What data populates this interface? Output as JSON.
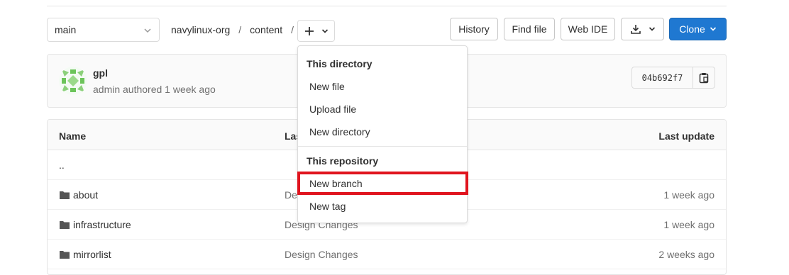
{
  "toolbar": {
    "branch": "main",
    "breadcrumb": [
      "navylinux-org",
      "content"
    ],
    "breadcrumb_sep": "/",
    "add_icon": "plus-icon",
    "history_label": "History",
    "find_file_label": "Find file",
    "web_ide_label": "Web IDE",
    "download_icon": "download-icon",
    "clone_label": "Clone",
    "accent_color": "#1f78d1"
  },
  "commit": {
    "title": "gpl",
    "meta": "admin authored 1 week ago",
    "sha": "04b692f7",
    "copy_icon": "clipboard-icon"
  },
  "dropdown": {
    "section1": "This directory",
    "items1": [
      "New file",
      "Upload file",
      "New directory"
    ],
    "section2": "This repository",
    "items2": [
      "New branch",
      "New tag"
    ],
    "highlight_color": "#e0141e"
  },
  "table": {
    "headers": [
      "Name",
      "Last commit",
      "Last update"
    ],
    "parent": "..",
    "rows": [
      {
        "name": "about",
        "message": "Design Changes",
        "updated": "1 week ago"
      },
      {
        "name": "infrastructure",
        "message": "Design Changes",
        "updated": "1 week ago"
      },
      {
        "name": "mirrorlist",
        "message": "Design Changes",
        "updated": "2 weeks ago"
      }
    ]
  }
}
